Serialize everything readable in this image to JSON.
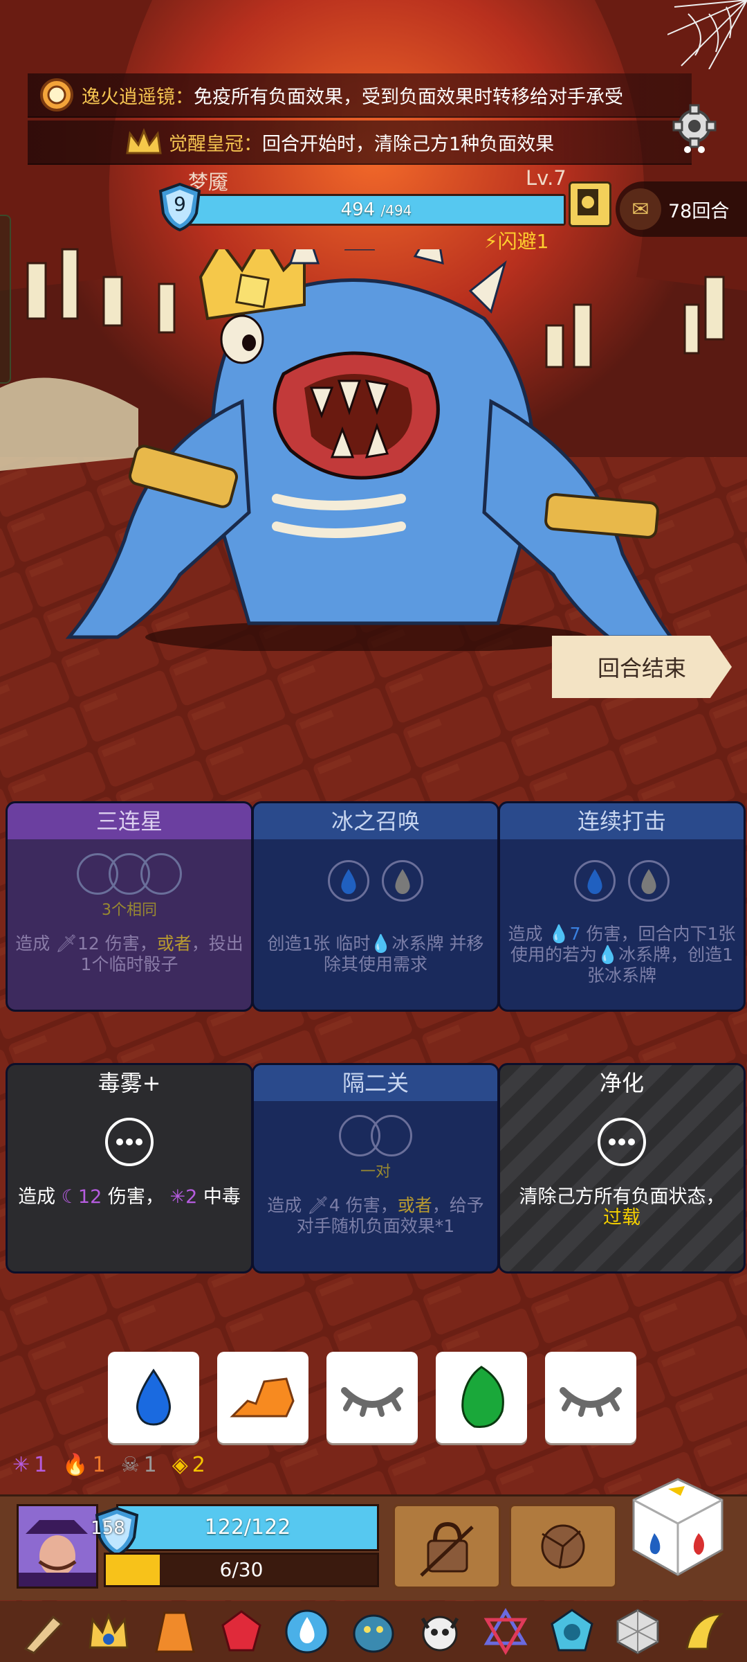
{
  "banners": [
    {
      "name": "逸火逍遥镜：",
      "text": "免疫所有负面效果，受到负面效果时转移给对手承受",
      "icon": "mirror-icon"
    },
    {
      "name": "觉醒皇冠：",
      "text": "回合开始时，清除己方1种负面效果",
      "icon": "crown-icon"
    }
  ],
  "boss": {
    "name": "梦魇",
    "level": "Lv.7",
    "shield": "9",
    "hp_current": "494",
    "hp_max": "/494",
    "hp_fraction": 1.0,
    "status": "闪避1"
  },
  "rounds": "78回合",
  "end_turn_label": "回合结束",
  "cards": [
    {
      "title": "三连星",
      "sub": "3个相同",
      "desc_a": "造成",
      "desc_num": "12",
      "desc_b": "伤害，",
      "desc_or": "或者",
      "desc_c": "，投出1个临时骰子"
    },
    {
      "title": "冰之召唤",
      "desc_a": "创造1张 临时",
      "desc_b": "冰系牌 并移除其使用需求"
    },
    {
      "title": "连续打击",
      "desc_a": "造成",
      "desc_num": "7",
      "desc_b": "伤害，回合内下1张使用的若为",
      "desc_c": "冰系牌，创造1张冰系牌"
    },
    {
      "title": "毒雾+",
      "desc_a": "造成",
      "desc_num": "12",
      "desc_b": "伤害，",
      "desc_num2": "2",
      "desc_c": "中毒"
    },
    {
      "title": "隔二关",
      "sub": "一对",
      "desc_a": "造成",
      "desc_num": "4",
      "desc_b": "伤害，",
      "desc_or": "或者",
      "desc_c": "，给予对手随机负面效果*1"
    },
    {
      "title": "净化",
      "desc_a": "清除己方所有负面状态，",
      "desc_hl": "过载"
    }
  ],
  "dice_faces": [
    "water",
    "fire",
    "closed-eye",
    "leaf",
    "closed-eye"
  ],
  "statuses": [
    {
      "icon": "poison-splat-icon",
      "value": "1",
      "color": "#b65ce0"
    },
    {
      "icon": "flame-icon",
      "value": "1",
      "color": "#f07a2a"
    },
    {
      "icon": "skull-icon",
      "value": "1",
      "color": "#9a9a9a"
    },
    {
      "icon": "diamond-arrow-icon",
      "value": "2",
      "color": "#f5c400"
    }
  ],
  "player": {
    "shield": "158",
    "hp_text": "122/122",
    "hp_fraction": 1.0,
    "xp_text": "6/30",
    "xp_fraction": 0.2
  },
  "items": [
    "horn-icon",
    "crown-item-icon",
    "robe-icon",
    "ruby-icon",
    "water-drop-item-icon",
    "dragon-icon",
    "demon-skull-icon",
    "hexagram-icon",
    "pumpkin-gem-icon",
    "d20-icon",
    "banana-claw-icon"
  ]
}
